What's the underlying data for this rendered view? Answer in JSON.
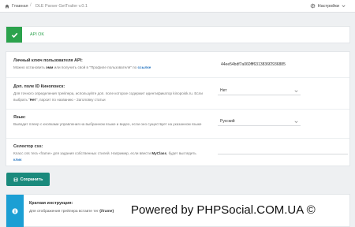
{
  "topbar": {
    "home_label": "Главная",
    "separator": "/",
    "module_title": "DLE Parser GetTrailer v.0.1",
    "settings_label": "Настройки"
  },
  "alert": {
    "status_color": "#2ba24c",
    "text": "API OK"
  },
  "settings": {
    "api_key": {
      "title": "Личный ключ пользователя API:",
      "desc_before": "Можно остановить ",
      "desc_bold": "эмм",
      "desc_middle": " или получить свой в \"Профиле пользователя\" по ",
      "desc_link": "ссылке",
      "value": "44ee54bdf7a060fff6313836f2936885"
    },
    "kinopoisk_field": {
      "title": "Доп. поле ID Кинопоиск:",
      "desc_before": "Для точного определения трейлера, используйте доп. поле которое содержит идентификатор kinopoisk.ru. Если выбрать \"",
      "desc_bold": "Нет",
      "desc_after": "\", парсит по названию - Заголовку статьи",
      "selected": "Нет"
    },
    "language": {
      "title": "Язык:",
      "desc": "Выводит плеер с кнопками управления на выбранном языке и видео, если оно существует на указанном языке",
      "selected": "Русский"
    },
    "css_selector": {
      "title": "Селектор css:",
      "desc_before": "Класс css тега «frame» для задания собственных стилей. Например, если ввести ",
      "desc_bold": "MyClass",
      "desc_middle": ", будет выглядеть ",
      "desc_link": "клик",
      "value": ""
    }
  },
  "save_button": {
    "label": "Сохранить",
    "color": "#1a8a7c"
  },
  "info": {
    "accent": "#1b9fd4",
    "title": "Краткая инструкция:",
    "text_before": "Для отображения трейлера вставте тег ",
    "text_bold": "{iframe}"
  },
  "watermark": "Powered by PHPSocial.COM.UA ©"
}
